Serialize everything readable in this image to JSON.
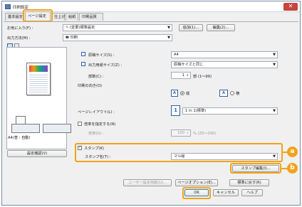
{
  "window": {
    "title": "印刷設定",
    "close_label": "✕"
  },
  "tabs": [
    {
      "label": "基本設定"
    },
    {
      "label": "ページ設定"
    },
    {
      "label": "仕上げ"
    },
    {
      "label": "給紙"
    },
    {
      "label": "印刷品質"
    }
  ],
  "favorites": {
    "label": "お気に入り(F) :",
    "value": "(変更)標準設定",
    "add_button": "追加(1)...",
    "edit_button": "編集(2)..."
  },
  "output_method": {
    "label": "出力方法(M) :",
    "value": "印刷"
  },
  "preview": {
    "caption": "A4(普 : 自動)",
    "settings_button": "設定確認(V)"
  },
  "page_settings": {
    "original_size_label": "原稿サイズ(S) :",
    "original_size_value": "A4",
    "output_size_label": "出力用紙サイズ(Z) :",
    "output_size_value": "原稿サイズと同じ",
    "copies_label": "部数(C) :",
    "copies_value": "1",
    "copies_unit": "部 (1～99)",
    "orientation_label": "印刷の向き(O)",
    "portrait_icon": "A",
    "portrait_label": "縦",
    "landscape_icon": "A",
    "landscape_label": "横",
    "layout_label": "ページレイアウト(L) :",
    "layout_icon": "1",
    "layout_value": "1 in 1(標準)",
    "scale_checkbox": "倍率を指定する(N)",
    "scale_label": "倍率(G) :",
    "scale_value": "100",
    "scale_unit": "% (25～200)",
    "stamp_checkbox": "スタンプ(K)",
    "stamp_name_label": "スタンプ名(T) :",
    "stamp_name_value": "マル秘",
    "stamp_edit_button": "スタンプ編集(I)..."
  },
  "footer": {
    "user_settings_button": "ユーザー設定用紙(U)...",
    "page_options_button": "ページオプション(E)...",
    "restore_button": "標準に戻す(R)",
    "ok_button": "OK",
    "cancel_button": "キャンセル",
    "help_button": "ヘルプ"
  },
  "annotations": {
    "a": "a",
    "b": "b"
  },
  "colors": {
    "highlight": "#f2a31b"
  }
}
